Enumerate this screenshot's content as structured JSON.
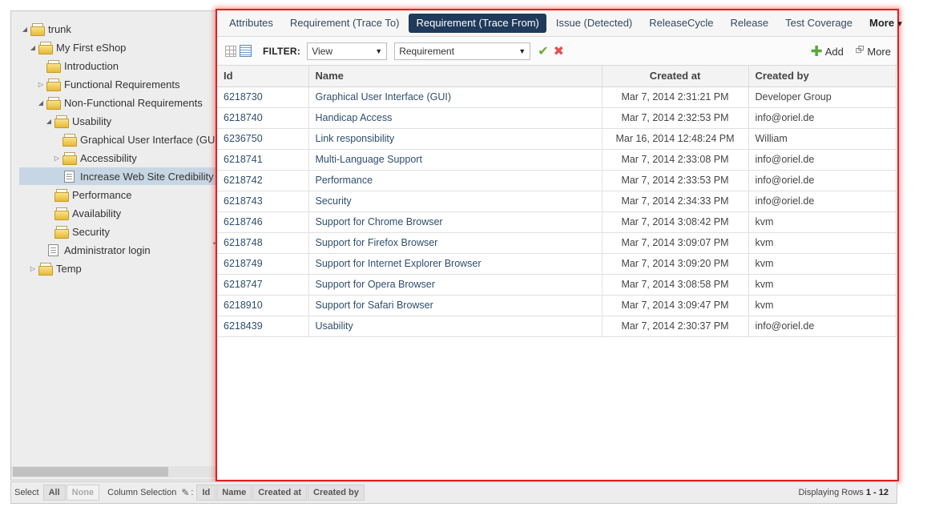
{
  "tree": {
    "nodes": [
      {
        "label": "trunk",
        "icon": "folder-icon",
        "toggle": "▲",
        "level": 0
      },
      {
        "label": "My First eShop",
        "icon": "folder-icon",
        "toggle": "▲",
        "level": 1
      },
      {
        "label": "Introduction",
        "icon": "folder-icon",
        "toggle": "",
        "level": 2
      },
      {
        "label": "Functional Requirements",
        "icon": "folder-icon",
        "toggle": "▷",
        "level": 2
      },
      {
        "label": "Non-Functional Requirements",
        "icon": "folder-icon",
        "toggle": "▲",
        "level": 2
      },
      {
        "label": "Usability",
        "icon": "folder-icon",
        "toggle": "▲",
        "level": 3
      },
      {
        "label": "Graphical User Interface (GUI)",
        "icon": "folder-icon",
        "toggle": "",
        "level": 4
      },
      {
        "label": "Accessibility",
        "icon": "folder-icon",
        "toggle": "▷",
        "level": 4
      },
      {
        "label": "Increase Web Site Credibility",
        "icon": "doc-icon",
        "toggle": "",
        "level": 4,
        "selected": true
      },
      {
        "label": "Performance",
        "icon": "folder-icon",
        "toggle": "",
        "level": 3
      },
      {
        "label": "Availability",
        "icon": "folder-icon",
        "toggle": "",
        "level": 3
      },
      {
        "label": "Security",
        "icon": "folder-icon",
        "toggle": "",
        "level": 3
      },
      {
        "label": "Administrator login",
        "icon": "doc-icon",
        "toggle": "",
        "level": 2
      },
      {
        "label": "Temp",
        "icon": "folder-icon",
        "toggle": "▷",
        "level": 1
      }
    ]
  },
  "tabs": [
    {
      "label": "Attributes",
      "active": false
    },
    {
      "label": "Requirement (Trace To)",
      "active": false
    },
    {
      "label": "Requirement (Trace From)",
      "active": true
    },
    {
      "label": "Issue (Detected)",
      "active": false
    },
    {
      "label": "ReleaseCycle",
      "active": false
    },
    {
      "label": "Release",
      "active": false
    },
    {
      "label": "Test Coverage",
      "active": false
    }
  ],
  "tabs_more": "More",
  "toolbar": {
    "filter_label": "FILTER:",
    "view_select": "View",
    "type_select": "Requirement",
    "add_label": "Add",
    "more_label": "More"
  },
  "grid": {
    "columns": [
      "Id",
      "Name",
      "Created at",
      "Created by"
    ],
    "rows": [
      {
        "id": "6218730",
        "name": "Graphical User Interface (GUI)",
        "created_at": "Mar 7, 2014 2:31:21 PM",
        "created_by": "Developer Group"
      },
      {
        "id": "6218740",
        "name": "Handicap Access",
        "created_at": "Mar 7, 2014 2:32:53 PM",
        "created_by": "info@oriel.de"
      },
      {
        "id": "6236750",
        "name": "Link responsibility",
        "created_at": "Mar 16, 2014 12:48:24 PM",
        "created_by": "William"
      },
      {
        "id": "6218741",
        "name": "Multi-Language Support",
        "created_at": "Mar 7, 2014 2:33:08 PM",
        "created_by": "info@oriel.de"
      },
      {
        "id": "6218742",
        "name": "Performance",
        "created_at": "Mar 7, 2014 2:33:53 PM",
        "created_by": "info@oriel.de"
      },
      {
        "id": "6218743",
        "name": "Security",
        "created_at": "Mar 7, 2014 2:34:33 PM",
        "created_by": "info@oriel.de"
      },
      {
        "id": "6218746",
        "name": "Support for Chrome Browser",
        "created_at": "Mar 7, 2014 3:08:42 PM",
        "created_by": "kvm"
      },
      {
        "id": "6218748",
        "name": "Support for Firefox Browser",
        "created_at": "Mar 7, 2014 3:09:07 PM",
        "created_by": "kvm"
      },
      {
        "id": "6218749",
        "name": "Support for Internet Explorer Browser",
        "created_at": "Mar 7, 2014 3:09:20 PM",
        "created_by": "kvm"
      },
      {
        "id": "6218747",
        "name": "Support for Opera Browser",
        "created_at": "Mar 7, 2014 3:08:58 PM",
        "created_by": "kvm"
      },
      {
        "id": "6218910",
        "name": "Support for Safari Browser",
        "created_at": "Mar 7, 2014 3:09:47 PM",
        "created_by": "kvm"
      },
      {
        "id": "6218439",
        "name": "Usability",
        "created_at": "Mar 7, 2014 2:30:37 PM",
        "created_by": "info@oriel.de"
      }
    ]
  },
  "bottom": {
    "select_label": "Select",
    "all_label": "All",
    "none_label": "None",
    "column_selection_label": "Column Selection",
    "colon": ":",
    "column_buttons": [
      "Id",
      "Name",
      "Created at",
      "Created by"
    ],
    "displaying_label": "Displaying Rows",
    "displaying_range": "1 - 12"
  },
  "colors": {
    "active_tab": "#1f3a5b",
    "highlight_border": "#e02020",
    "tree_selected": "#c7d6e4",
    "link_text": "#2f4e6e"
  }
}
